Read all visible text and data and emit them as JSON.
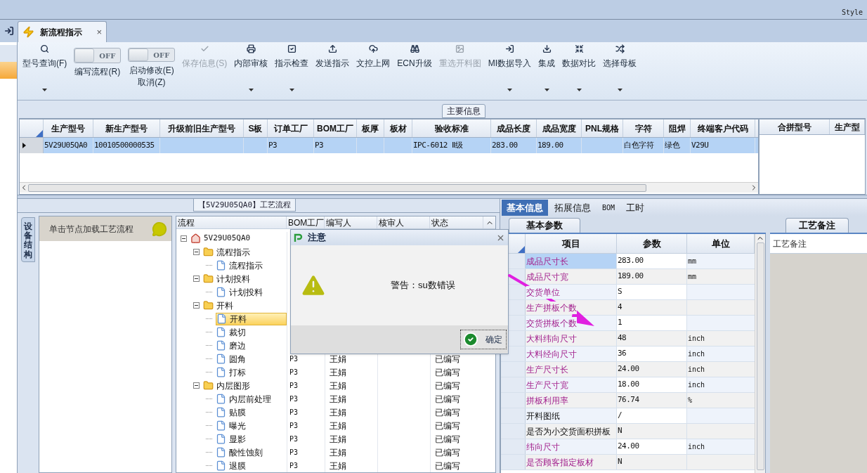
{
  "top_bar": {
    "style_label": "Style"
  },
  "document_tab": {
    "title": "新流程指示",
    "close": "×",
    "selected": true
  },
  "toolbar": [
    {
      "kind": "button",
      "label": [
        "型号查询(F)"
      ],
      "disabled": false,
      "dropdown": true
    },
    {
      "kind": "toggle",
      "label": [
        "编写流程(R)"
      ],
      "on": false,
      "switch_text": "OFF",
      "dropdown": false
    },
    {
      "kind": "toggle",
      "label": [
        "启动修改(E)",
        "取消(Z)"
      ],
      "on": false,
      "switch_text": "OFF",
      "dropdown": false
    },
    {
      "kind": "button",
      "label": [
        "保存信息(S)"
      ],
      "disabled": true,
      "dropdown": false
    },
    {
      "kind": "button",
      "label": [
        "内部审核"
      ],
      "disabled": false,
      "dropdown": true
    },
    {
      "kind": "button",
      "label": [
        "指示检查"
      ],
      "disabled": false,
      "dropdown": true
    },
    {
      "kind": "button",
      "label": [
        "发送指示"
      ],
      "disabled": false,
      "dropdown": false
    },
    {
      "kind": "button",
      "label": [
        "文控上网"
      ],
      "disabled": false,
      "dropdown": false
    },
    {
      "kind": "button",
      "label": [
        "ECN升级"
      ],
      "disabled": false,
      "dropdown": false
    },
    {
      "kind": "button",
      "label": [
        "重选开料图"
      ],
      "disabled": true,
      "dropdown": false
    },
    {
      "kind": "button",
      "label": [
        "MI数据导入"
      ],
      "disabled": false,
      "dropdown": true
    },
    {
      "kind": "button",
      "label": [
        "集成"
      ],
      "disabled": false,
      "dropdown": true
    },
    {
      "kind": "button",
      "label": [
        "数据对比"
      ],
      "disabled": false,
      "dropdown": true
    },
    {
      "kind": "button",
      "label": [
        "选择母板"
      ],
      "disabled": false,
      "dropdown": true
    }
  ],
  "main_info": {
    "title": "主要信息",
    "columns": [
      "生产型号",
      "新生产型号",
      "升级前旧生产型号",
      "S板",
      "订单工厂",
      "BOM工厂",
      "板厚",
      "板材",
      "验收标准",
      "成品长度",
      "成品宽度",
      "PNL规格",
      "字符",
      "阻焊",
      "终端客户代码"
    ],
    "rows": [
      {
        "selected": true,
        "cells": [
          "5V29U05QA0",
          "10010500000535",
          null,
          null,
          "P3",
          "P3",
          null,
          null,
          "IPC-6012 Ⅱ级",
          "283.00",
          "189.00",
          null,
          "白色字符",
          "绿色",
          "V29U"
        ]
      }
    ],
    "side_columns": [
      "合拼型号",
      "生产型"
    ]
  },
  "process": {
    "title": "【5V29U05QA0】工艺流程",
    "side_tab": "设备结构",
    "device_hint": "单击节点加载工艺流程",
    "tree_columns": [
      "流程",
      "BOM工厂",
      "编写人",
      "核审人",
      "状态"
    ],
    "tree": [
      {
        "kind": "root",
        "label": "5V29U05QA0",
        "expanded": true,
        "selected": false,
        "children": [
          {
            "kind": "folder",
            "label": "流程指示",
            "expanded": true,
            "selected": false,
            "children": [
              {
                "kind": "step",
                "label": "流程指示",
                "selected": false
              }
            ]
          },
          {
            "kind": "folder",
            "label": "计划投料",
            "expanded": true,
            "selected": false,
            "children": [
              {
                "kind": "step",
                "label": "计划投料",
                "selected": false
              }
            ]
          },
          {
            "kind": "folder",
            "label": "开料",
            "expanded": true,
            "selected": false,
            "children": [
              {
                "kind": "step",
                "label": "开料",
                "selected": true
              },
              {
                "kind": "step",
                "label": "裁切",
                "selected": false
              },
              {
                "kind": "step",
                "label": "磨边",
                "selected": false
              },
              {
                "kind": "step",
                "label": "圆角",
                "selected": false,
                "bom": "P3",
                "writer": "王娟",
                "status": "已编写"
              },
              {
                "kind": "step",
                "label": "打标",
                "selected": false,
                "bom": "P3",
                "writer": "王娟",
                "status": "已编写"
              }
            ]
          },
          {
            "kind": "folder",
            "label": "内层图形",
            "expanded": true,
            "selected": false,
            "bom": "P3",
            "writer": "王娟",
            "status": "已编写",
            "children": [
              {
                "kind": "step",
                "label": "内层前处理",
                "selected": false,
                "bom": "P3",
                "writer": "王娟",
                "status": "已编写"
              },
              {
                "kind": "step",
                "label": "贴膜",
                "selected": false,
                "bom": "P3",
                "writer": "王娟",
                "status": "已编写"
              },
              {
                "kind": "step",
                "label": "曝光",
                "selected": false,
                "bom": "P3",
                "writer": "王娟",
                "status": "已编写"
              },
              {
                "kind": "step",
                "label": "显影",
                "selected": false,
                "bom": "P3",
                "writer": "王娟",
                "status": "已编写"
              },
              {
                "kind": "step",
                "label": "酸性蚀刻",
                "selected": false,
                "bom": "P3",
                "writer": "王娟",
                "status": "已编写"
              },
              {
                "kind": "step",
                "label": "退膜",
                "selected": false,
                "bom": "P3",
                "writer": "王娟",
                "status": "已编写"
              }
            ]
          }
        ]
      }
    ]
  },
  "details": {
    "tabs": [
      {
        "label": "基本信息",
        "selected": true
      },
      {
        "label": "拓展信息",
        "selected": false
      },
      {
        "label": "BOM",
        "selected": false
      },
      {
        "label": "工时",
        "selected": false
      }
    ],
    "params_tab": "基本参数",
    "columns": [
      "项目",
      "参数",
      "单位"
    ],
    "rows": [
      {
        "item": "成品尺寸长",
        "value": "283.00",
        "unit": "mm",
        "flagged": true,
        "selected": true
      },
      {
        "item": "成品尺寸宽",
        "value": "189.00",
        "unit": "mm",
        "flagged": true,
        "selected": false
      },
      {
        "item": "交货单位",
        "value": "S",
        "flagged": true,
        "selected": false
      },
      {
        "item": "生产拼板个数",
        "value": "4",
        "flagged": true,
        "selected": false
      },
      {
        "item": "交货拼板个数",
        "value": "1",
        "flagged": true,
        "selected": false
      },
      {
        "item": "大料纬向尺寸",
        "value": "48",
        "unit": "inch",
        "flagged": true,
        "selected": false
      },
      {
        "item": "大料经向尺寸",
        "value": "36",
        "unit": "inch",
        "flagged": true,
        "selected": false
      },
      {
        "item": "生产尺寸长",
        "value": "24.00",
        "unit": "inch",
        "flagged": true,
        "selected": false
      },
      {
        "item": "生产尺寸宽",
        "value": "18.00",
        "unit": "inch",
        "flagged": true,
        "selected": false
      },
      {
        "item": "拼板利用率",
        "value": "76.74",
        "unit": "%",
        "flagged": true,
        "selected": false
      },
      {
        "item": "开料图纸",
        "value": "/",
        "flagged": false,
        "selected": false
      },
      {
        "item": "是否为小交货面积拼板",
        "value": "N",
        "flagged": false,
        "selected": false
      },
      {
        "item": "纬向尺寸",
        "value": "24.00",
        "unit": "inch",
        "flagged": true,
        "selected": false
      },
      {
        "item": "是否顾客指定板材",
        "value": "N",
        "flagged": true,
        "selected": false
      }
    ],
    "notes_tab": "工艺备注",
    "notes_header": "工艺备注"
  },
  "dialog": {
    "title": "注意",
    "message": "警告：su数错误",
    "ok": "确定"
  }
}
